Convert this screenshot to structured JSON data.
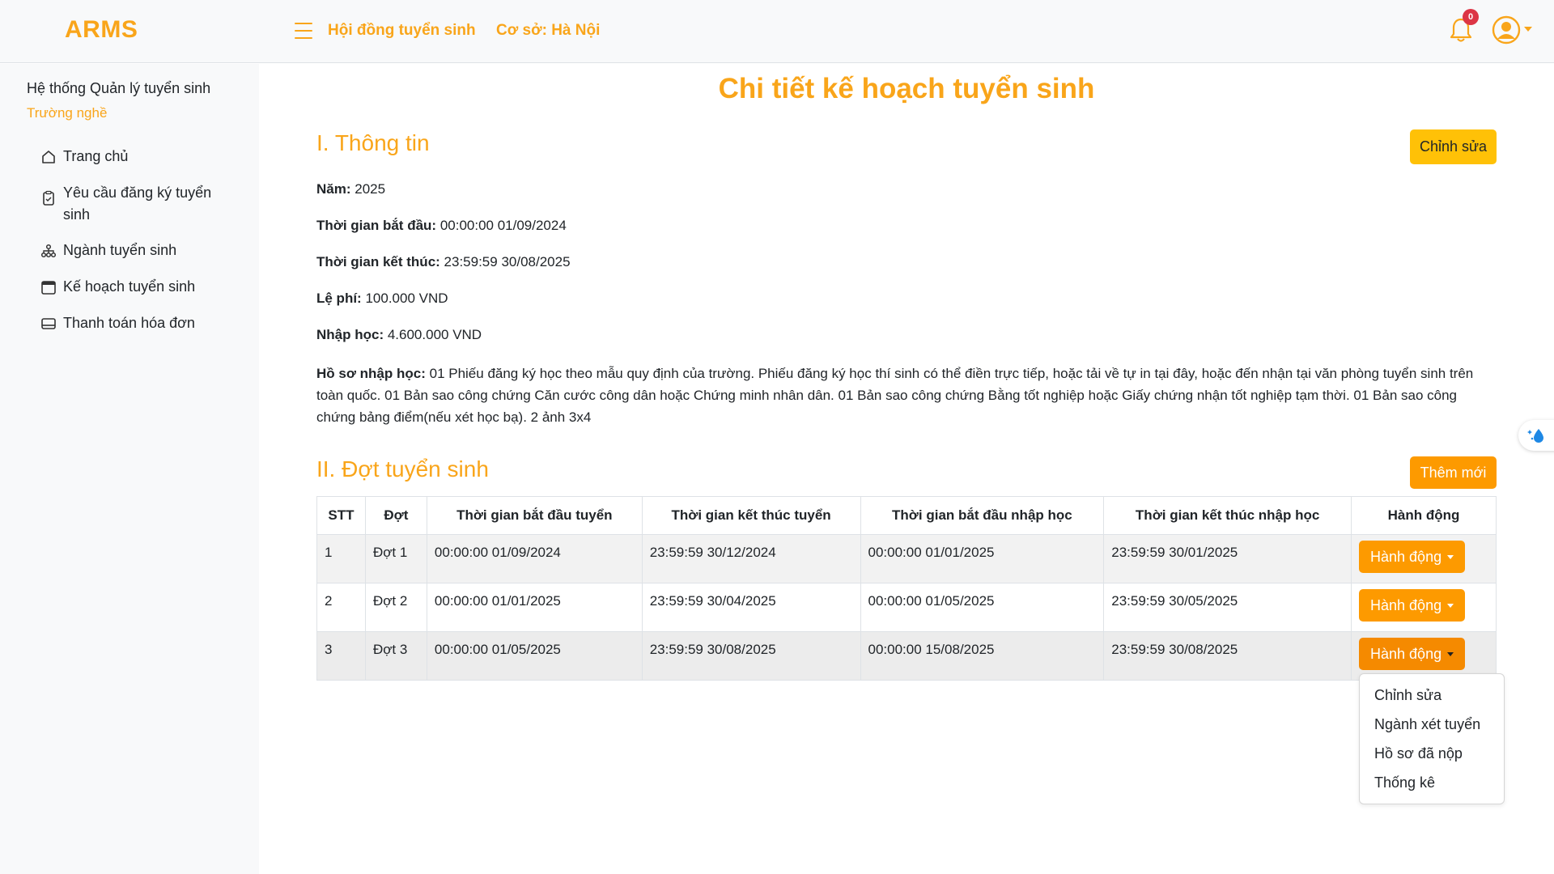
{
  "header": {
    "logo": "ARMS",
    "nav_council": "Hội đồng tuyển sinh",
    "nav_campus": "Cơ sở: Hà Nội",
    "notification_count": "0"
  },
  "sidebar": {
    "title": "Hệ thống Quản lý tuyển sinh",
    "subtitle": "Trường nghề",
    "items": [
      {
        "label": "Trang chủ",
        "icon": "home-icon"
      },
      {
        "label": "Yêu cầu đăng ký tuyển sinh",
        "icon": "clipboard-icon"
      },
      {
        "label": "Ngành tuyển sinh",
        "icon": "sitemap-icon"
      },
      {
        "label": "Kế hoạch tuyển sinh",
        "icon": "calendar-icon"
      },
      {
        "label": "Thanh toán hóa đơn",
        "icon": "credit-card-icon"
      }
    ]
  },
  "main": {
    "page_title": "Chi tiết kế hoạch tuyển sinh",
    "section1_title": "I. Thông tin",
    "edit_button": "Chỉnh sửa",
    "info": {
      "year_label": "Năm:",
      "year_value": "2025",
      "start_label": "Thời gian bắt đầu:",
      "start_value": "00:00:00 01/09/2024",
      "end_label": "Thời gian kết thúc:",
      "end_value": "23:59:59 30/08/2025",
      "fee_label": "Lệ phí:",
      "fee_value": "100.000 VND",
      "enroll_label": "Nhập học:",
      "enroll_value": "4.600.000 VND",
      "docs_label": "Hồ sơ nhập học:",
      "docs_value": "01 Phiếu đăng ký học theo mẫu quy định của trường. Phiếu đăng ký học thí sinh có thể điền trực tiếp, hoặc tải về tự in tại đây, hoặc đến nhận tại văn phòng tuyển sinh trên toàn quốc. 01 Bản sao công chứng Căn cước công dân hoặc Chứng minh nhân dân. 01 Bản sao công chứng Bằng tốt nghiệp hoặc Giấy chứng nhận tốt nghiệp tạm thời. 01 Bản sao công chứng bảng điểm(nếu xét học bạ). 2 ảnh 3x4"
    },
    "section2_title": "II. Đợt tuyển sinh",
    "add_button": "Thêm mới",
    "table": {
      "headers": [
        "STT",
        "Đợt",
        "Thời gian bắt đầu tuyển",
        "Thời gian kết thúc tuyển",
        "Thời gian bắt đầu nhập học",
        "Thời gian kết thúc nhập học",
        "Hành động"
      ],
      "rows": [
        {
          "stt": "1",
          "dot": "Đợt 1",
          "start_recruit": "00:00:00 01/09/2024",
          "end_recruit": "23:59:59 30/12/2024",
          "start_enroll": "00:00:00 01/01/2025",
          "end_enroll": "23:59:59 30/01/2025",
          "action": "Hành động"
        },
        {
          "stt": "2",
          "dot": "Đợt 2",
          "start_recruit": "00:00:00 01/01/2025",
          "end_recruit": "23:59:59 30/04/2025",
          "start_enroll": "00:00:00 01/05/2025",
          "end_enroll": "23:59:59 30/05/2025",
          "action": "Hành động"
        },
        {
          "stt": "3",
          "dot": "Đợt 3",
          "start_recruit": "00:00:00 01/05/2025",
          "end_recruit": "23:59:59 30/08/2025",
          "start_enroll": "00:00:00 15/08/2025",
          "end_enroll": "23:59:59 30/08/2025",
          "action": "Hành động"
        }
      ]
    },
    "dropdown": {
      "items": [
        "Chỉnh sửa",
        "Ngành xét tuyển",
        "Hồ sơ đã nộp",
        "Thống kê"
      ]
    }
  },
  "colors": {
    "brand": "#f9a51a",
    "button_orange": "#fd9a00",
    "button_yellow": "#ffc107",
    "badge_red": "#dc3545",
    "sidebar_bg": "#f8f9fa"
  }
}
